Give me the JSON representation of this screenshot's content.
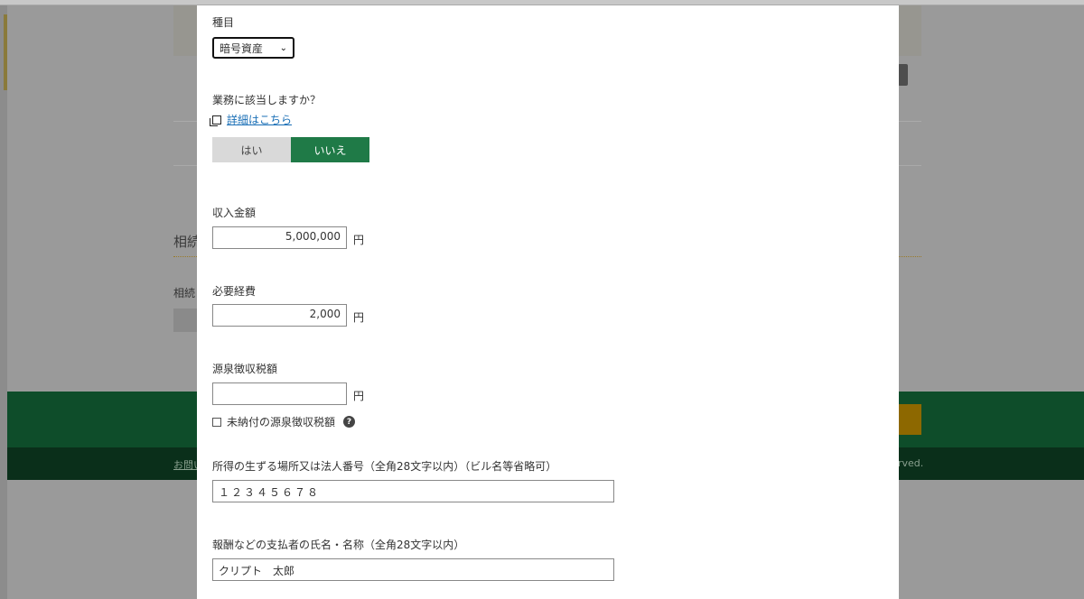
{
  "background": {
    "heading": "相続",
    "subtext": "相続",
    "footer_left": "お問い",
    "footer_right": "rved."
  },
  "form": {
    "category": {
      "label": "種目",
      "selected": "暗号資産"
    },
    "business": {
      "question": "業務に該当しますか？",
      "detail_link": "詳細はこちら",
      "options": [
        "はい",
        "いいえ"
      ],
      "selected": "いいえ"
    },
    "income": {
      "label": "収入金額",
      "value": "5,000,000",
      "unit": "円"
    },
    "expenses": {
      "label": "必要経費",
      "value": "2,000",
      "unit": "円"
    },
    "withholding": {
      "label": "源泉徴収税額",
      "value": "",
      "unit": "円",
      "unpaid_checkbox_label": "未納付の源泉徴収税額",
      "unpaid_checked": false
    },
    "place": {
      "label": "所得の生ずる場所又は法人番号（全角28文字以内）（ビル名等省略可）",
      "value": "１２３４５６７８"
    },
    "payer": {
      "label": "報酬などの支払者の氏名・名称（全角28文字以内）",
      "value": "クリプト　太郎"
    }
  },
  "colors": {
    "accent_green": "#1f7a47",
    "link_blue": "#1a6fb6",
    "toggle_off": "#d9d9d9"
  },
  "icons": [
    "document-icon",
    "help-icon",
    "chevron-down-icon"
  ]
}
